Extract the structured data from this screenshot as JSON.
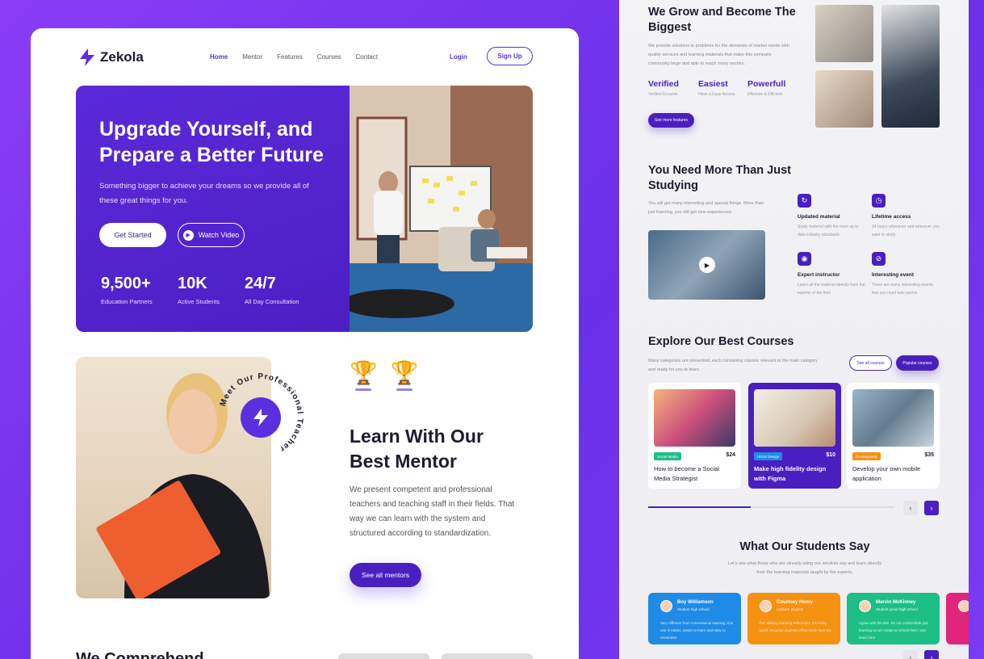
{
  "colors": {
    "accent": "#4a1fc0",
    "background": "#7a35f0",
    "blue": "#1f8be6",
    "orange": "#f59212",
    "green": "#1ebf86",
    "pink": "#e0257a"
  },
  "brand": {
    "name": "Zekola",
    "icon": "lightning-bolt-icon"
  },
  "nav": {
    "items": [
      "Home",
      "Mentor",
      "Features",
      "Courses",
      "Contact"
    ],
    "active": "Home",
    "login": "Login",
    "signup": "Sign Up"
  },
  "hero": {
    "title": "Upgrade Yourself, and Prepare a Better Future",
    "subtitle": "Something bigger to achieve your dreams so we provide all of these great things for you.",
    "get_started": "Get Started",
    "watch_video": "Watch Video",
    "stats": [
      {
        "value": "9,500+",
        "label": "Education Partners"
      },
      {
        "value": "10K",
        "label": "Active Students"
      },
      {
        "value": "24/7",
        "label": "All Day Consultation"
      }
    ]
  },
  "mentor": {
    "ring_text": "Meet Our Professional Teacher",
    "title": "Learn With Our Best Mentor",
    "description": "We present competent and professional teachers and teaching staff in their fields. That way we can learn with the system and structured according to standardization.",
    "button": "See all mentors",
    "trophy_icon": "trophy-icon"
  },
  "next_section": {
    "title_partial": "We Comprehend"
  },
  "grow": {
    "title": "We Grow and Become The Biggest",
    "description": "We provide solutions to problems for the demands of market needs with quality services and learning materials that make this company community large and able to reach many sectors.",
    "features": [
      {
        "title": "Verified",
        "subtitle": "Verified Ecourse"
      },
      {
        "title": "Easiest",
        "subtitle": "Have a Easy Access"
      },
      {
        "title": "Powerfull",
        "subtitle": "Effective & Efficient"
      }
    ],
    "button": "See more features"
  },
  "need": {
    "title": "You Need More Than Just Studying",
    "description": "You will get many interesting and special things. More than just learning, you will get new experiences.",
    "benefits": [
      {
        "title": "Updated material",
        "text": "Study material with the most up to date industry standards",
        "icon": "refresh-icon"
      },
      {
        "title": "Lifetime access",
        "text": "24 hours whenever and wherever you want to study",
        "icon": "clock-icon"
      },
      {
        "title": "Expert instructor",
        "text": "Learn all the material directly from the experts of the field",
        "icon": "user-icon"
      },
      {
        "title": "Interesting event",
        "text": "There are many interesting events that you must take part in",
        "icon": "compass-icon"
      }
    ]
  },
  "courses": {
    "title": "Explore Our Best Courses",
    "description": "Many categories are presented, each containing classes relevant to the main category and ready for you to learn.",
    "see_all": "See all courses",
    "popular": "Popular courses",
    "items": [
      {
        "tag": "Social Media",
        "price": "$24",
        "title": "How to become a Social Media Strategist",
        "tag_color": "#1ebf86"
      },
      {
        "tag": "UI/UX Design",
        "price": "$10",
        "title": "Make high fidelity design with Figma",
        "tag_color": "#1f8be6"
      },
      {
        "tag": "Development",
        "price": "$35",
        "title": "Develop your own mobile application",
        "tag_color": "#f59212"
      }
    ]
  },
  "students": {
    "title": "What Our Students Say",
    "description": "Let's see what those who are already using our services say and learn directly from the learning materials taught by the experts.",
    "items": [
      {
        "name": "Boy Williamson",
        "role": "Student high school",
        "text": "Very different from conventional learning, this one is easier, easier to learn and easy to remember"
      },
      {
        "name": "Courtney Henry",
        "role": "Lecturer physics",
        "text": "For utilizing learning references, it's really good, because students effort study here too"
      },
      {
        "name": "Marvin McKinney",
        "role": "Student junior high school",
        "text": "Agree with the title. It's not comfortable just learning so we create at school then I can learn here"
      }
    ]
  }
}
